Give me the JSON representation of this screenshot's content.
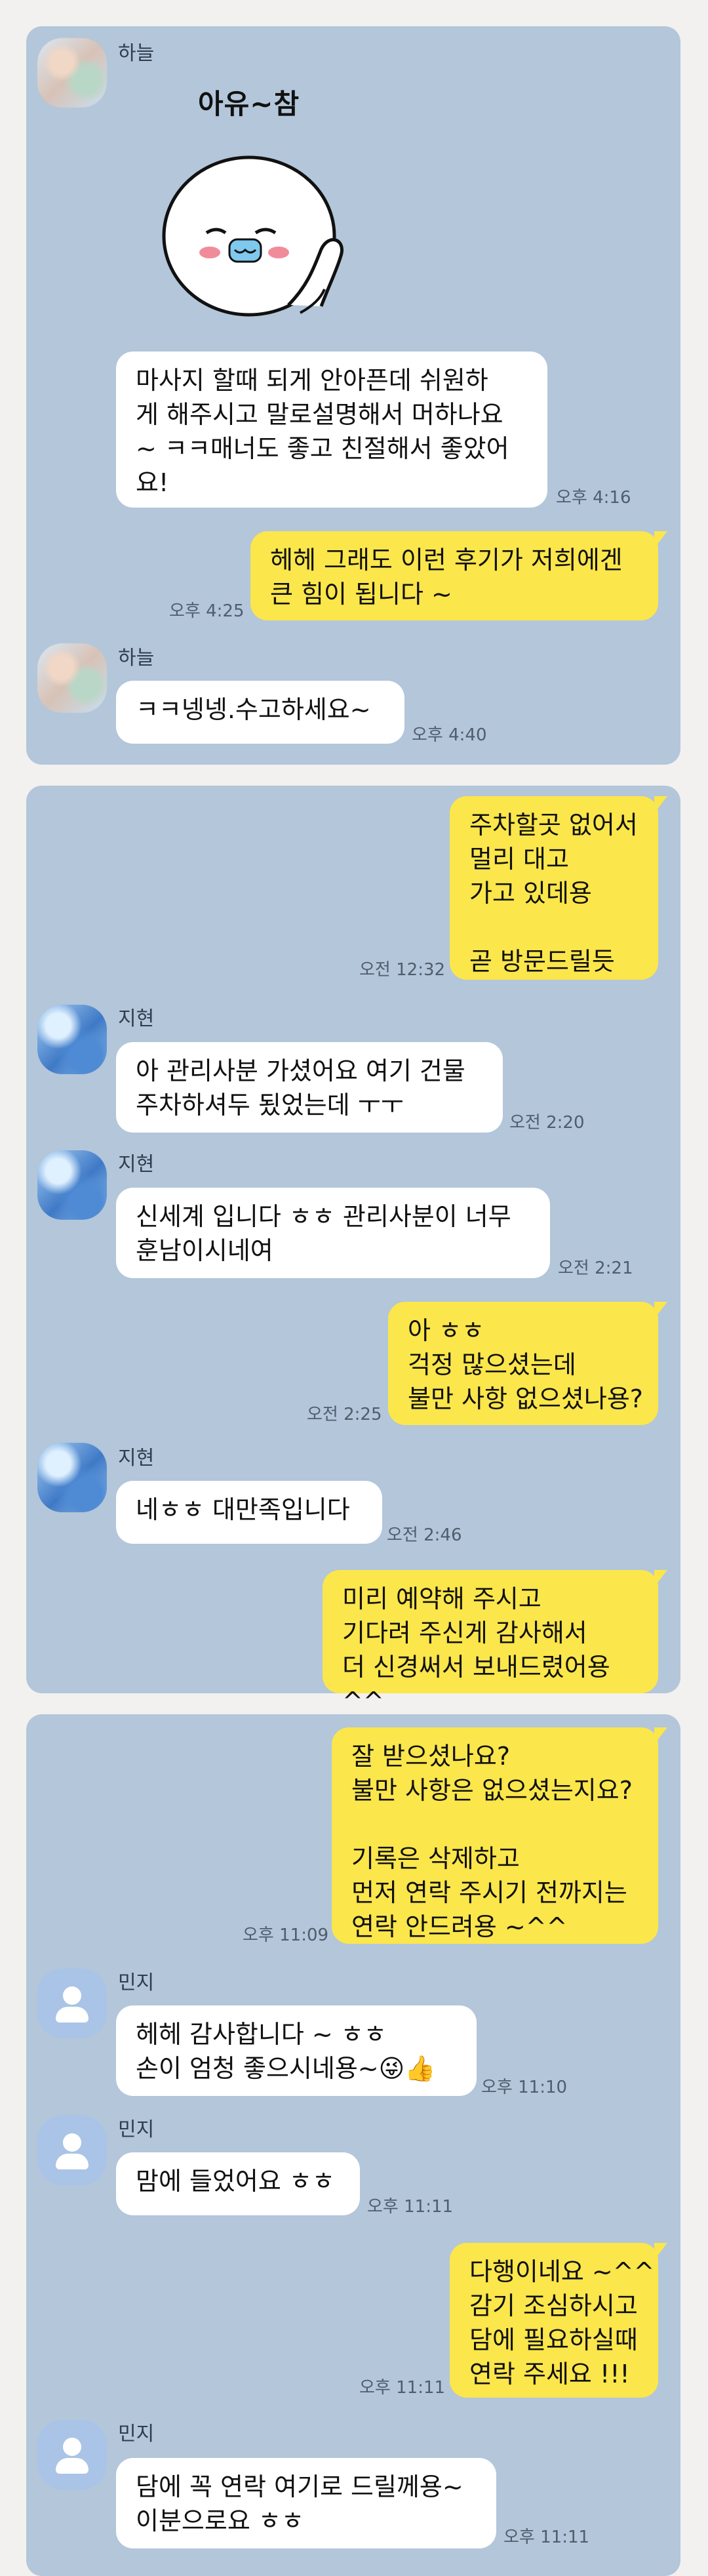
{
  "panel1": {
    "sender1": "하늘",
    "sticker_text": "아유~참",
    "msg1": "마사지 할때 되게 안아픈데 쉬원하\n게 해주시고 말로설명해서 머하나요\n~ ㅋㅋ매너도 좋고 친절해서 좋았어\n요!",
    "time1": "오후 4:16",
    "reply1": "헤헤 그래도 이런 후기가 저희에겐\n큰 힘이 됩니다 ~",
    "reply1_time": "오후 4:25",
    "sender2": "하늘",
    "msg2": "ㅋㅋ넹넹.수고하세요~",
    "time2": "오후 4:40"
  },
  "panel2": {
    "out1": "주차할곳 없어서\n멀리 대고\n가고 있데용\n\n곧 방문드릴듯",
    "out1_time": "오전 12:32",
    "sender1": "지현",
    "msg1": "아 관리사분 가셨어요 여기 건물\n주차하셔두 됬었는데 ㅜㅜ",
    "time1": "오전 2:20",
    "sender2": "지현",
    "msg2": "신세계 입니다 ㅎㅎ 관리사분이 너무\n훈남이시네여",
    "time2": "오전 2:21",
    "out2": "아 ㅎㅎ\n걱정 많으셨는데\n불만 사항 없으셨나용?",
    "out2_time": "오전 2:25",
    "sender3": "지현",
    "msg3": "네ㅎㅎ 대만족입니다",
    "time3": "오전 2:46",
    "out3": "미리 예약해 주시고\n기다려 주신게 감사해서\n더 신경써서 보내드렸어용 ^^"
  },
  "panel3": {
    "out1": "잘 받으셨나요?\n불만 사항은 없으셨는지요?\n\n기록은 삭제하고\n먼저 연락 주시기 전까지는\n연락 안드려용 ~^^",
    "out1_time": "오후 11:09",
    "sender1": "민지",
    "msg1": "헤헤 감사합니다 ~ ㅎㅎ\n손이 엄청 좋으시네용~😜👍",
    "time1": "오후 11:10",
    "sender2": "민지",
    "msg2": "맘에 들었어요 ㅎㅎ",
    "time2": "오후 11:11",
    "out2": "다행이네요 ~^^\n감기 조심하시고\n담에 필요하실때\n연락 주세요 !!!",
    "out2_time": "오후 11:11",
    "sender3": "민지",
    "msg3": "담에 꼭 연락 여기로 드릴께용~\n이분으로요 ㅎㅎ",
    "time3": "오후 11:11"
  },
  "colors": {
    "chat_background": "#b3c6da",
    "outgoing_bubble": "#fbe64b",
    "incoming_bubble": "#ffffff"
  }
}
